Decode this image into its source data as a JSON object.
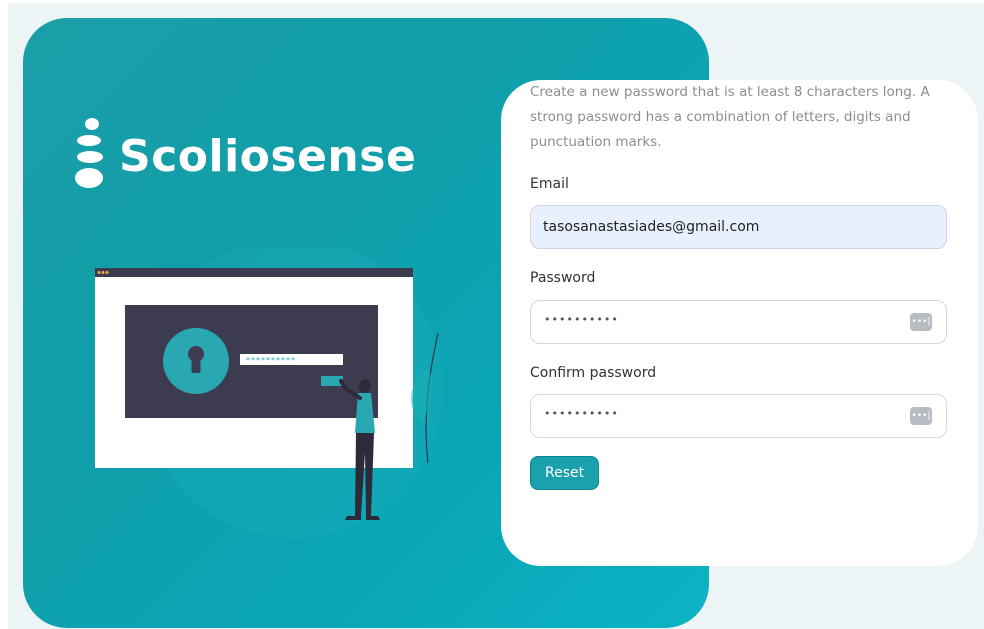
{
  "brand": {
    "name": "Scoliosense"
  },
  "form": {
    "description": "Create a new password that is at least 8 characters long. A strong password has a combination of letters, digits and punctuation marks.",
    "email_label": "Email",
    "email_value": "tasosanastasiades@gmail.com",
    "password_label": "Password",
    "password_masked": "••••••••••",
    "confirm_label": "Confirm password",
    "confirm_masked": "••••••••••",
    "toggle_glyph": "•••|",
    "reset_label": "Reset"
  },
  "illustration": {
    "password_field_text": "**********"
  },
  "colors": {
    "brand_teal": "#1aa1ad",
    "hero_gradient_start": "#1b9fa9",
    "hero_gradient_end": "#0cb3c4",
    "illustration_dark": "#3c3b4f",
    "page_background": "#ecf4f5"
  },
  "icons": {
    "password_toggle": "password-reveal-icon",
    "lock": "keyhole-lock-icon"
  }
}
